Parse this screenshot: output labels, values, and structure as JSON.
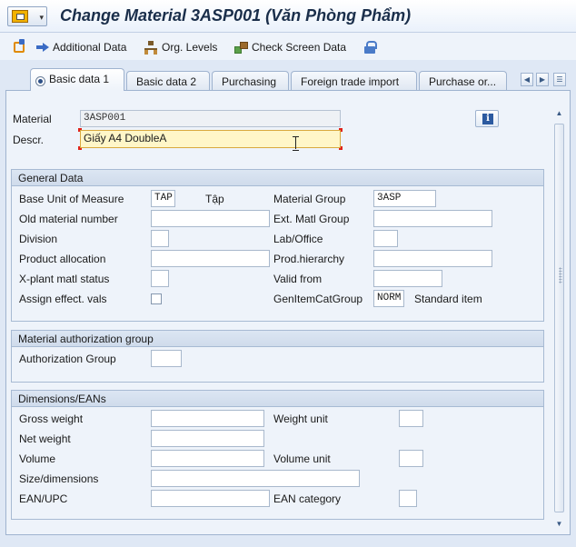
{
  "window": {
    "title": "Change Material 3ASP001 (Văn Phòng Phẩm)"
  },
  "toolbar": {
    "items": [
      {
        "label": "",
        "icon": "copy-icon"
      },
      {
        "label": "Additional Data",
        "icon": "arrow-right-icon"
      },
      {
        "label": "Org. Levels",
        "icon": "org-structure-icon"
      },
      {
        "label": "Check Screen Data",
        "icon": "check-screen-icon"
      },
      {
        "label": "",
        "icon": "lock-icon"
      }
    ]
  },
  "tabs": {
    "items": [
      {
        "label": "Basic data 1",
        "active": true
      },
      {
        "label": "Basic data 2"
      },
      {
        "label": "Purchasing"
      },
      {
        "label": "Foreign trade import"
      },
      {
        "label": "Purchase or..."
      }
    ]
  },
  "header": {
    "material_label": "Material",
    "material_value": "3ASP001",
    "descr_label": "Descr.",
    "descr_value": "Giấy A4 DoubleA",
    "info_icon": "info-icon"
  },
  "general": {
    "title": "General Data",
    "base_uom_label": "Base Unit of Measure",
    "base_uom_value": "TAP",
    "base_uom_text": "Tập",
    "material_group_label": "Material Group",
    "material_group_value": "3ASP",
    "old_material_label": "Old material number",
    "old_material_value": "",
    "ext_matl_group_label": "Ext. Matl Group",
    "ext_matl_group_value": "",
    "division_label": "Division",
    "division_value": "",
    "lab_office_label": "Lab/Office",
    "lab_office_value": "",
    "product_allocation_label": "Product allocation",
    "product_allocation_value": "",
    "prod_hierarchy_label": "Prod.hierarchy",
    "prod_hierarchy_value": "",
    "xplant_status_label": "X-plant matl status",
    "xplant_status_value": "",
    "valid_from_label": "Valid from",
    "valid_from_value": "",
    "assign_effect_label": "Assign effect. vals",
    "assign_effect_checked": false,
    "gen_item_cat_label": "GenItemCatGroup",
    "gen_item_cat_value": "NORM",
    "gen_item_cat_text": "Standard item"
  },
  "auth": {
    "title": "Material authorization group",
    "auth_group_label": "Authorization Group",
    "auth_group_value": ""
  },
  "dims": {
    "title": "Dimensions/EANs",
    "gross_weight_label": "Gross weight",
    "gross_weight_value": "",
    "weight_unit_label": "Weight unit",
    "weight_unit_value": "",
    "net_weight_label": "Net weight",
    "net_weight_value": "",
    "volume_label": "Volume",
    "volume_value": "",
    "volume_unit_label": "Volume unit",
    "volume_unit_value": "",
    "size_label": "Size/dimensions",
    "size_value": "",
    "ean_label": "EAN/UPC",
    "ean_value": "",
    "ean_category_label": "EAN category",
    "ean_category_value": ""
  },
  "colors": {
    "background": "#dfe8f5",
    "panel": "#eef3fa",
    "focus_field": "#fff6c8",
    "title_text": "#1a2e4a"
  }
}
